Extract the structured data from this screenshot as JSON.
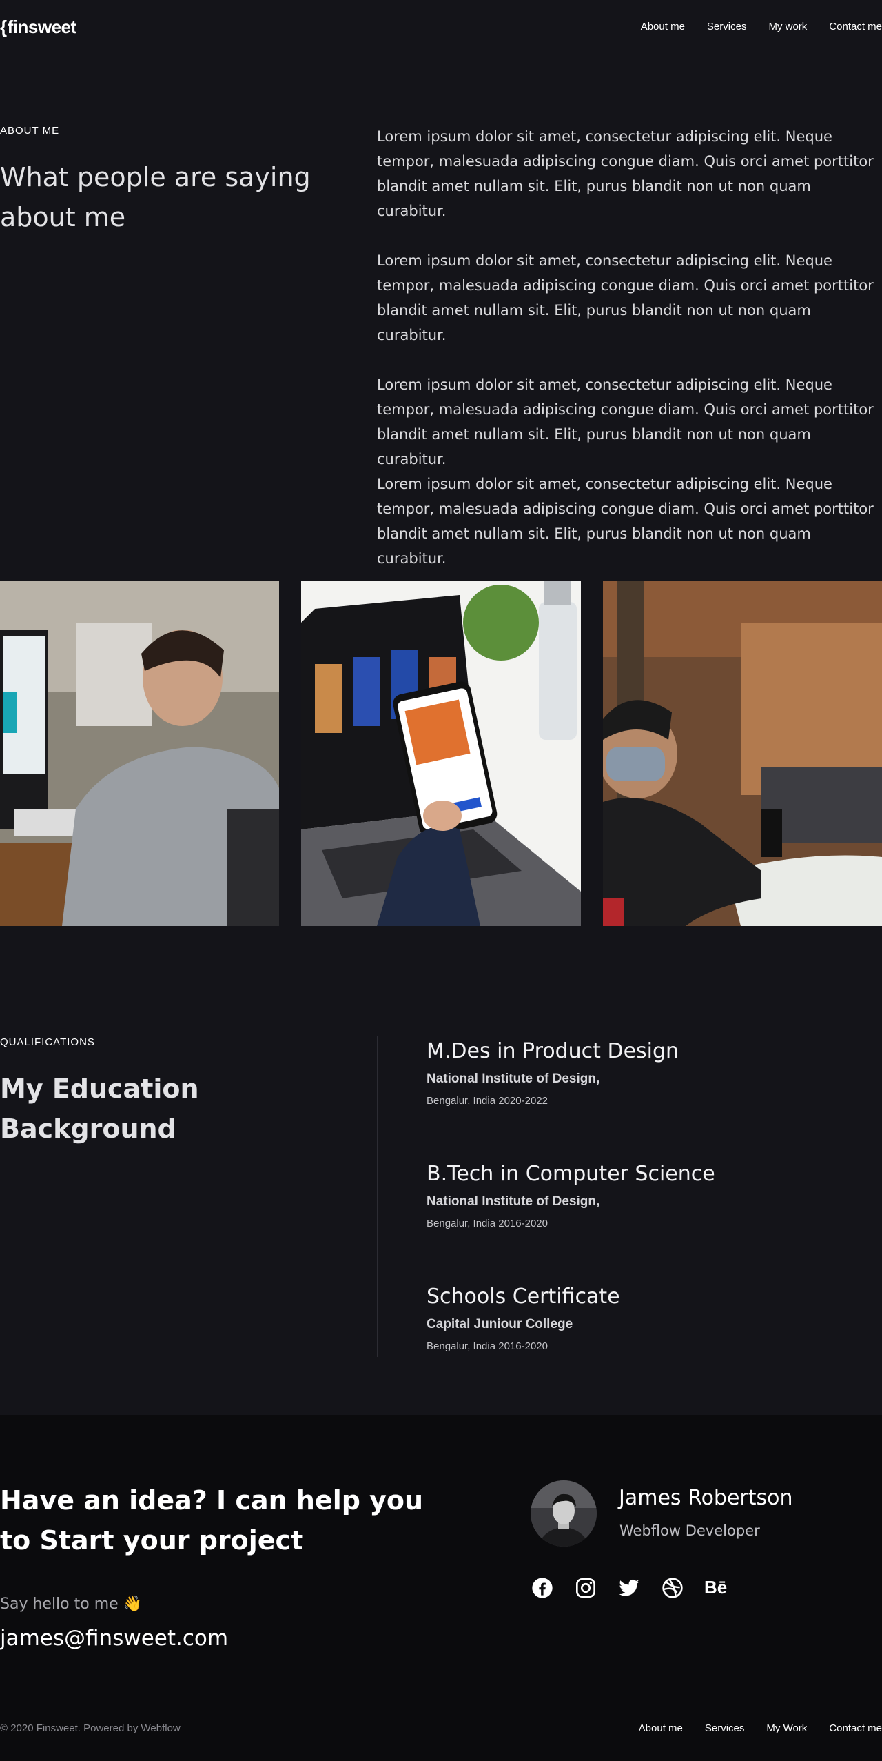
{
  "nav": {
    "logo": "finsweet",
    "links": [
      "About me",
      "Services",
      "My work",
      "Contact me"
    ]
  },
  "about": {
    "eyebrow": "ABOUT ME",
    "title": "What people are saying about me",
    "paragraphs": [
      "Lorem ipsum dolor sit amet, consectetur adipiscing elit. Neque tempor, malesuada adipiscing congue diam. Quis orci amet porttitor blandit amet nullam sit. Elit, purus blandit non ut non quam curabitur.",
      "Lorem ipsum dolor sit amet, consectetur adipiscing elit. Neque tempor, malesuada adipiscing congue diam. Quis orci amet porttitor blandit amet nullam sit. Elit, purus blandit non ut non quam curabitur.",
      "Lorem ipsum dolor sit amet, consectetur adipiscing elit. Neque tempor, malesuada adipiscing congue diam. Quis orci amet porttitor blandit amet nullam sit. Elit, purus blandit non ut non quam curabitur.",
      "Lorem ipsum dolor sit amet, consectetur adipiscing elit. Neque tempor, malesuada adipiscing congue diam. Quis orci amet porttitor blandit amet nullam sit. Elit, purus blandit non ut non quam curabitur."
    ]
  },
  "gallery": {
    "images": [
      "man-at-desktop-photo",
      "phone-and-laptop-photo",
      "man-with-mask-at-laptop-photo"
    ]
  },
  "qualifications": {
    "eyebrow": "QUALIFICATIONS",
    "title": "My Education Background",
    "items": [
      {
        "degree": "M.Des in Product Design",
        "institution": "National Institute of Design,",
        "meta": "Bengalur, India 2020-2022"
      },
      {
        "degree": "B.Tech in Computer Science",
        "institution": "National Institute of Design,",
        "meta": "Bengalur, India 2016-2020"
      },
      {
        "degree": "Schools Certificate",
        "institution": "Capital Juniour College",
        "meta": "Bengalur, India 2016-2020"
      }
    ]
  },
  "contact": {
    "cta": "Have an idea? I can help you to Start your project",
    "hello": "Say hello to me 👋",
    "email": "james@finsweet.com",
    "name": "James Robertson",
    "role": "Webflow Developer",
    "socials": [
      "facebook-icon",
      "instagram-icon",
      "twitter-icon",
      "dribbble-icon",
      "behance-icon"
    ],
    "behance_label": "Bē"
  },
  "footer": {
    "copyright": "© 2020 Finsweet. Powered by Webflow",
    "links": [
      "About me",
      "Services",
      "My Work",
      "Contact me"
    ]
  },
  "colors": {
    "background_upper": "#141419",
    "background_lower": "#0b0b0d",
    "text": "#ffffff"
  }
}
